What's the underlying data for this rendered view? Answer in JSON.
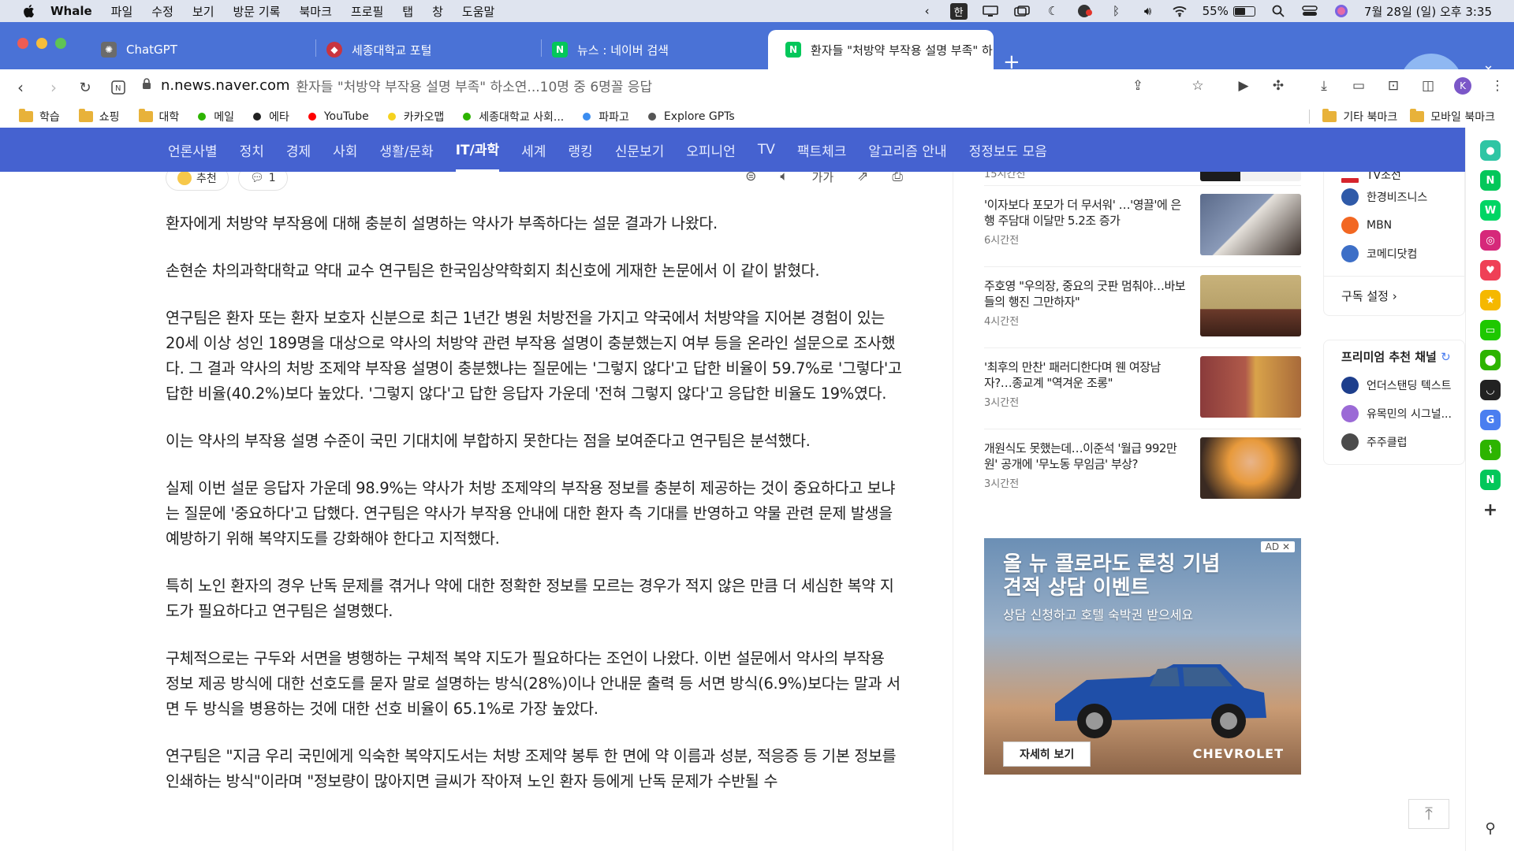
{
  "menubar": {
    "app": "Whale",
    "items": [
      "파일",
      "수정",
      "보기",
      "방문 기록",
      "북마크",
      "프로필",
      "탭",
      "창",
      "도움말"
    ],
    "ime": "한",
    "battery": "55%",
    "datetime": "7월 28일 (일) 오후 3:35"
  },
  "tabs": [
    {
      "label": "ChatGPT",
      "favicon": "chatgpt-icon",
      "color": "#6b6b6b"
    },
    {
      "label": "세종대학교 포털",
      "favicon": "sejong-icon",
      "color": "#c9343f"
    },
    {
      "label": "뉴스 : 네이버 검색",
      "favicon": "naver-icon",
      "color": "#03c75a"
    },
    {
      "label": "환자들 \"처방약 부작용 설명 부족\" 하",
      "favicon": "naver-icon",
      "color": "#03c75a"
    }
  ],
  "address": {
    "domain": "n.news.naver.com",
    "title": "환자들 \"처방약 부작용 설명 부족\" 하소연...10명 중 6명꼴 응답"
  },
  "bookmarks": [
    {
      "label": "학습",
      "type": "folder"
    },
    {
      "label": "쇼핑",
      "type": "folder"
    },
    {
      "label": "대학",
      "type": "folder"
    },
    {
      "label": "메일",
      "type": "dot",
      "color": "#2db400"
    },
    {
      "label": "에타",
      "type": "dot",
      "color": "#222222"
    },
    {
      "label": "YouTube",
      "type": "dot",
      "color": "#ff0000"
    },
    {
      "label": "카카오맵",
      "type": "dot",
      "color": "#f5d21f"
    },
    {
      "label": "세종대학교 사회...",
      "type": "dot",
      "color": "#2db400"
    },
    {
      "label": "파파고",
      "type": "dot",
      "color": "#3b8df0"
    },
    {
      "label": "Explore GPTs",
      "type": "dot",
      "color": "#555555"
    }
  ],
  "bookmarks_right": [
    "기타 북마크",
    "모바일 북마크"
  ],
  "gnb": [
    "언론사별",
    "정치",
    "경제",
    "사회",
    "생활/문화",
    "IT/과학",
    "세계",
    "랭킹",
    "신문보기",
    "오피니언",
    "TV",
    "팩트체크",
    "알고리즘 안내",
    "정정보도 모음"
  ],
  "gnb_active": "IT/과학",
  "article": {
    "like_label": "추천",
    "comment_count": "1",
    "font_label": "가가",
    "paragraphs": [
      "환자에게 처방약 부작용에 대해 충분히 설명하는 약사가 부족하다는 설문 결과가 나왔다.",
      "손현순 차의과학대학교 약대 교수 연구팀은 한국임상약학회지 최신호에 게재한 논문에서 이 같이 밝혔다.",
      "연구팀은 환자 또는 환자 보호자 신분으로 최근 1년간 병원 처방전을 가지고 약국에서 처방약을 지어본 경험이 있는 20세 이상 성인 189명을 대상으로 약사의 처방약 관련 부작용 설명이 충분했는지 여부 등을 온라인 설문으로 조사했다. 그 결과 약사의 처방 조제약 부작용 설명이 충분했냐는 질문에는 '그렇지 않다'고 답한 비율이 59.7%로 '그렇다'고 답한 비율(40.2%)보다 높았다. '그렇지 않다'고 답한 응답자 가운데 '전혀 그렇지 않다'고 응답한 비율도 19%였다.",
      "이는 약사의 부작용 설명 수준이 국민 기대치에 부합하지 못한다는 점을 보여준다고 연구팀은 분석했다.",
      "실제 이번 설문 응답자 가운데 98.9%는 약사가 처방 조제약의 부작용 정보를 충분히 제공하는 것이 중요하다고 보냐는 질문에 '중요하다'고 답했다. 연구팀은 약사가 부작용 안내에 대한 환자 측 기대를 반영하고 약물 관련 문제 발생을 예방하기 위해 복약지도를 강화해야 한다고 지적했다.",
      "특히 노인 환자의 경우 난독 문제를 겪거나 약에 대한 정확한 정보를 모르는 경우가 적지 않은 만큼 더 세심한 복약 지도가 필요하다고 연구팀은 설명했다.",
      "구체적으로는 구두와 서면을 병행하는 구체적 복약 지도가 필요하다는 조언이 나왔다. 이번 설문에서 약사의 부작용 정보 제공 방식에 대한 선호도를 묻자 말로 설명하는 방식(28%)이나 안내문 출력 등 서면 방식(6.9%)보다는 말과 서면 두 방식을 병용하는 것에 대한 선호 비율이 65.1%로 가장 높았다.",
      "연구팀은 \"지금 우리 국민에게 익숙한 복약지도서는 처방 조제약 봉투 한 면에 약 이름과 성분, 적응증 등 기본 정보를 인쇄하는 방식\"이라며 \"정보량이 많아지면 글씨가 작아져 노인 환자 등에게 난독 문제가 수반될 수"
    ]
  },
  "news": [
    {
      "title": "15시간전",
      "time": "",
      "thumb": [
        "#1c1c1c",
        "#f2f2f2"
      ]
    },
    {
      "title": "'이자보다 포모가 더 무서워' …'영끌'에 은행 주담대 이달만 5.2조 증가",
      "time": "6시간전",
      "thumb": [
        "#5a6a8a",
        "#e6e2dc"
      ]
    },
    {
      "title": "주호영 \"우의장, 중요의 굿판 멈춰야…바보들의 행진 그만하자\"",
      "time": "4시간전",
      "thumb": [
        "#b7a16a",
        "#6b3a2a"
      ]
    },
    {
      "title": "'최후의 만찬' 패러디한다며 웬 여장남자?…종교계 \"역겨운 조롱\"",
      "time": "3시간전",
      "thumb": [
        "#8a3b3b",
        "#d9a34a"
      ]
    },
    {
      "title": "개원식도 못했는데…이준석 '월급 992만원' 공개에 '무노동 무임금' 부상?",
      "time": "3시간전",
      "thumb": [
        "#e89a3c",
        "#3a2a22"
      ]
    }
  ],
  "ad": {
    "tag": "AD",
    "headline1": "올 뉴 콜로라도 론칭 기념",
    "headline2": "견적 상담 이벤트",
    "sub": "상담 신청하고 호텔 숙박권 받으세요",
    "button": "자세히 보기",
    "brand": "CHEVROLET"
  },
  "channels": [
    {
      "label": "TV조선",
      "color": "#d6242c"
    },
    {
      "label": "한경비즈니스",
      "color": "#2f5aa8"
    },
    {
      "label": "MBN",
      "color": "#f26722"
    },
    {
      "label": "코메디닷컴",
      "color": "#3d6fc7"
    }
  ],
  "subscribe_setting": "구독 설정",
  "premium": {
    "title": "프리미엄 추천 채널",
    "items": [
      {
        "label": "언더스탠딩 텍스트",
        "color": "#1d3e8c"
      },
      {
        "label": "유목민의 시그널...",
        "color": "#9b6ad6"
      },
      {
        "label": "주주클럽",
        "color": "#4b4b4b"
      }
    ]
  },
  "sidebar_icons": [
    {
      "name": "whale-space-icon",
      "color": "#2fc5a4"
    },
    {
      "name": "naver-icon",
      "color": "#03c75a"
    },
    {
      "name": "webtoon-icon",
      "color": "#00d564"
    },
    {
      "name": "instagram-icon",
      "color": "#d6287a"
    },
    {
      "name": "pocket-icon",
      "color": "#ef4056"
    },
    {
      "name": "favorite-icon",
      "color": "#f5b800"
    },
    {
      "name": "naver-pay-icon",
      "color": "#1ec800"
    },
    {
      "name": "map-icon",
      "color": "#2db400"
    },
    {
      "name": "smile-icon",
      "color": "#222222"
    },
    {
      "name": "translate-icon",
      "color": "#4a7ef0"
    },
    {
      "name": "stock-icon",
      "color": "#2db400"
    },
    {
      "name": "naver-cafe-icon",
      "color": "#03c75a"
    }
  ]
}
